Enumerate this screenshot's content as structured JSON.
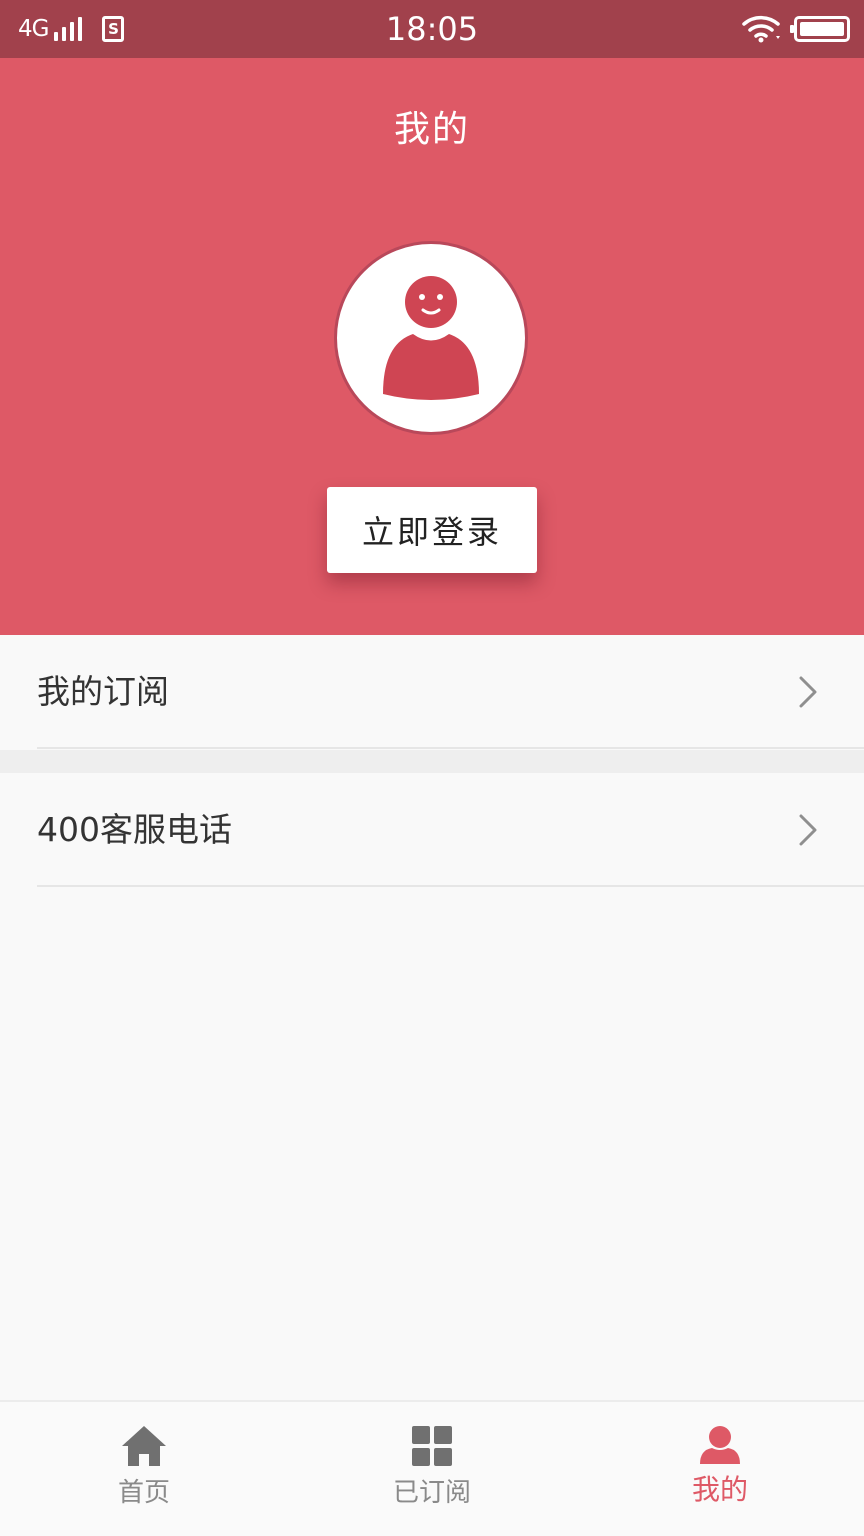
{
  "status_bar": {
    "network": "4G",
    "sim_label": "S",
    "time": "18:05"
  },
  "header": {
    "title": "我的",
    "login_button": "立即登录"
  },
  "menu": [
    {
      "label": "我的订阅",
      "icon": "chevron-right-icon"
    },
    {
      "label": "400客服电话",
      "icon": "chevron-right-icon"
    }
  ],
  "tabs": [
    {
      "label": "首页",
      "icon": "home-icon",
      "active": false
    },
    {
      "label": "已订阅",
      "icon": "grid-icon",
      "active": false
    },
    {
      "label": "我的",
      "icon": "person-icon",
      "active": true
    }
  ],
  "colors": {
    "status_bar": "#a1414c",
    "header": "#de5966",
    "accent": "#de5966",
    "avatar_figure": "#cf4553",
    "tab_inactive": "#707070",
    "background": "#f9f9f9"
  }
}
